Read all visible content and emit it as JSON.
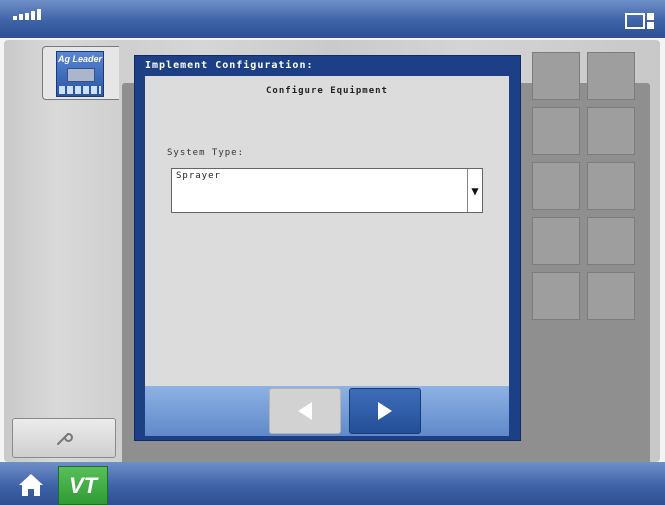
{
  "dialog": {
    "title": "Implement Configuration:",
    "subtitle": "Configure Equipment",
    "system_type_label": "System Type:",
    "system_type_value": "Sprayer"
  },
  "sidebar": {
    "logo_text": "Ag Leader"
  },
  "bottombar": {
    "vt_label": "VT"
  },
  "colors": {
    "accent_blue": "#2e4f92",
    "dialog_blue": "#1d3f86",
    "vt_green": "#3aa43c"
  },
  "icons": [
    "antenna-status-icon",
    "screens-icon",
    "ag-leader-icon",
    "wrench-icon",
    "back-arrow-icon",
    "next-arrow-icon",
    "home-icon",
    "vt-icon",
    "dropdown-arrow-icon"
  ]
}
